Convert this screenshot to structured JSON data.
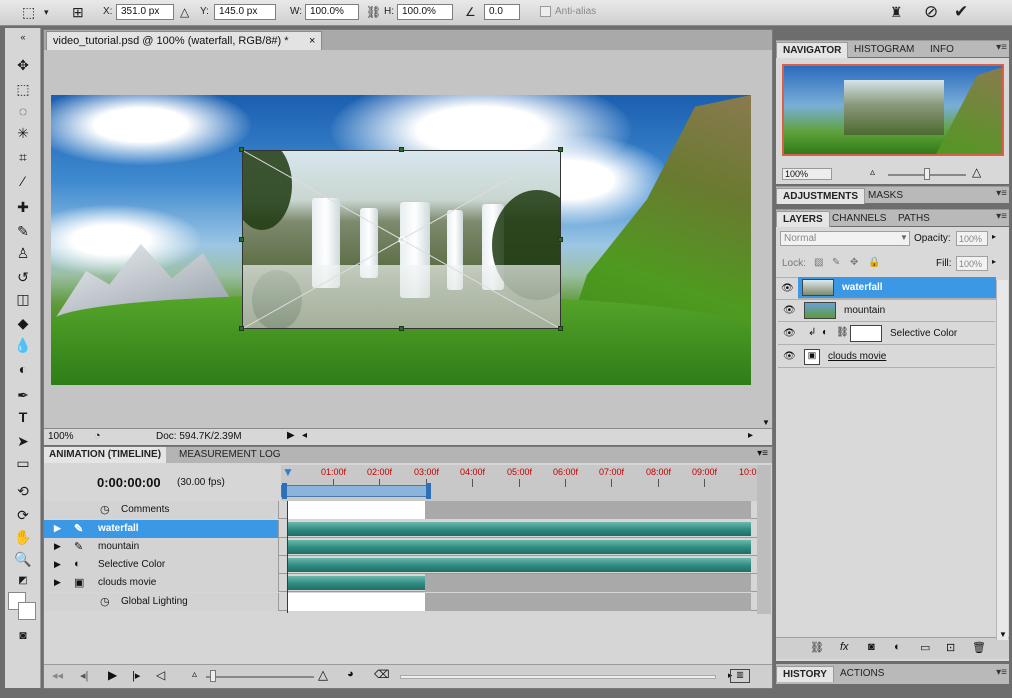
{
  "options_bar": {
    "x_label": "X:",
    "x_value": "351.0 px",
    "y_label": "Y:",
    "y_value": "145.0 px",
    "w_label": "W:",
    "w_value": "100.0%",
    "h_label": "H:",
    "h_value": "100.0%",
    "angle_value": "0.0",
    "antialias_label": "Anti-alias"
  },
  "document": {
    "tab_title": "video_tutorial.psd @ 100% (waterfall, RGB/8#) *",
    "close_glyph": "×",
    "zoom": "100%",
    "doc_info": "Doc: 594.7K/2.39M"
  },
  "timeline": {
    "tabs": [
      "ANIMATION (TIMELINE)",
      "MEASUREMENT LOG"
    ],
    "time_display": "0:00:00:00",
    "fps": "(30.00 fps)",
    "ruler_labels": [
      "01:00f",
      "02:00f",
      "03:00f",
      "04:00f",
      "05:00f",
      "06:00f",
      "07:00f",
      "08:00f",
      "09:00f",
      "10:0"
    ],
    "tracks": [
      {
        "name": "Comments",
        "kind": "stopwatch"
      },
      {
        "name": "waterfall",
        "kind": "layer",
        "selected": true
      },
      {
        "name": "mountain",
        "kind": "layer"
      },
      {
        "name": "Selective Color",
        "kind": "adjustment"
      },
      {
        "name": "clouds movie",
        "kind": "layer-short"
      },
      {
        "name": "Global Lighting",
        "kind": "stopwatch"
      }
    ]
  },
  "navigator": {
    "tabs": [
      "NAVIGATOR",
      "HISTOGRAM",
      "INFO"
    ],
    "zoom": "100%"
  },
  "adjustments": {
    "tabs": [
      "ADJUSTMENTS",
      "MASKS"
    ]
  },
  "layers": {
    "tabs": [
      "LAYERS",
      "CHANNELS",
      "PATHS"
    ],
    "blend_mode": "Normal",
    "opacity_label": "Opacity:",
    "opacity_value": "100%",
    "lock_label": "Lock:",
    "fill_label": "Fill:",
    "fill_value": "100%",
    "items": [
      {
        "name": "waterfall",
        "selected": true
      },
      {
        "name": "mountain"
      },
      {
        "name": "Selective Color"
      },
      {
        "name": "clouds movie"
      }
    ]
  },
  "history": {
    "tabs": [
      "HISTORY",
      "ACTIONS"
    ]
  },
  "colors": {
    "selection": "#3b98e4",
    "track_fill": "#2e8a80",
    "ruler_text": "#c00000",
    "navigator_frame": "#d8604a"
  }
}
